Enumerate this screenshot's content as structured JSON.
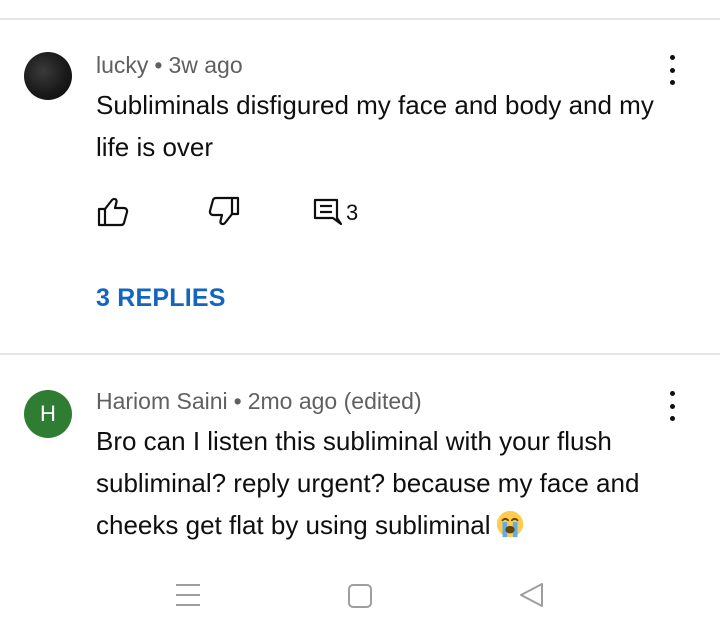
{
  "comments": [
    {
      "author": "lucky",
      "separator": "•",
      "time": "3w ago",
      "text": "Subliminals disfigured my face and body and my life is over",
      "reply_count": "3",
      "replies_link": "3 REPLIES",
      "avatar_color": "#1a1a1a"
    },
    {
      "author": "Hariom Saini",
      "separator": "•",
      "time": "2mo ago (edited)",
      "avatar_letter": "H",
      "avatar_color": "#2e7d32",
      "text": "Bro can I listen this subliminal with  your flush subliminal? reply urgent? because my face and cheeks  get flat by using subliminal",
      "emoji": "loudly-crying-face-emoji"
    }
  ],
  "colors": {
    "link_blue": "#1565c0",
    "meta_gray": "#606060",
    "divider": "#e5e5e5"
  },
  "icons": {
    "like": "thumb-up-icon",
    "dislike": "thumb-down-icon",
    "reply": "comment-icon",
    "more": "more-vert-icon",
    "nav_menu": "menu-icon",
    "nav_home": "square-icon",
    "nav_back": "back-triangle-icon"
  }
}
